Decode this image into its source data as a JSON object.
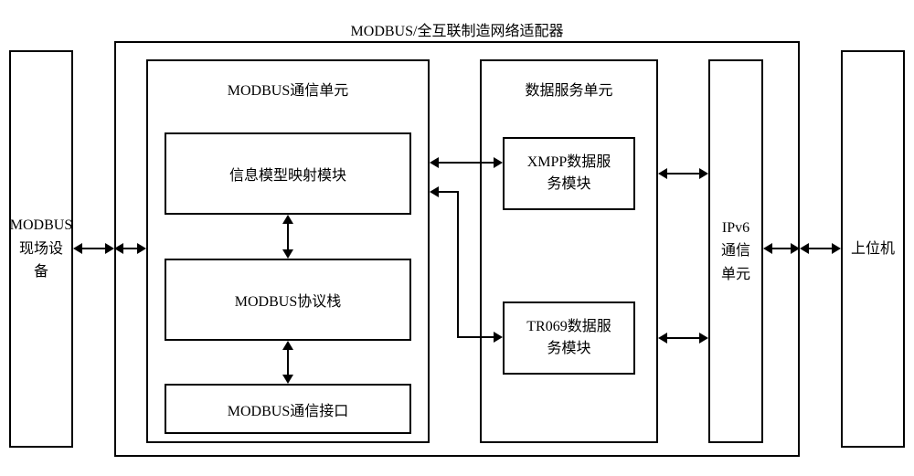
{
  "diagram_title": "MODBUS/全互联制造网络适配器",
  "left_device": "MODBUS\n现场设\n备",
  "right_device": "上位机",
  "modbus_unit_title": "MODBUS通信单元",
  "data_service_title": "数据服务单元",
  "ipv6_unit": "IPv6\n通信\n单元",
  "info_model_module": "信息模型映射模块",
  "modbus_stack": "MODBUS协议栈",
  "modbus_interface": "MODBUS通信接口",
  "xmpp_module": "XMPP数据服\n务模块",
  "tr069_module": "TR069数据服\n务模块"
}
